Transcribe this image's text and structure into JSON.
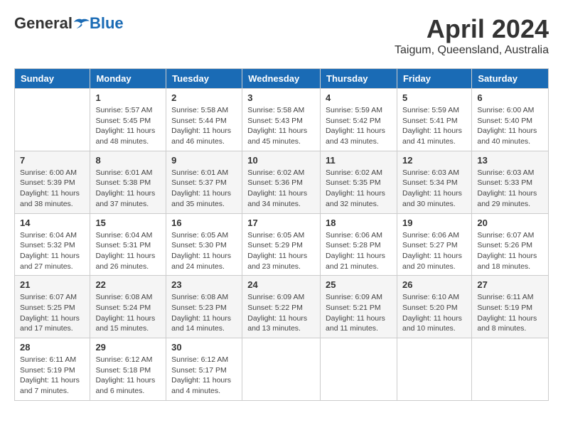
{
  "logo": {
    "general": "General",
    "blue": "Blue"
  },
  "title": "April 2024",
  "location": "Taigum, Queensland, Australia",
  "days_of_week": [
    "Sunday",
    "Monday",
    "Tuesday",
    "Wednesday",
    "Thursday",
    "Friday",
    "Saturday"
  ],
  "weeks": [
    [
      {
        "day": "",
        "info": ""
      },
      {
        "day": "1",
        "info": "Sunrise: 5:57 AM\nSunset: 5:45 PM\nDaylight: 11 hours\nand 48 minutes."
      },
      {
        "day": "2",
        "info": "Sunrise: 5:58 AM\nSunset: 5:44 PM\nDaylight: 11 hours\nand 46 minutes."
      },
      {
        "day": "3",
        "info": "Sunrise: 5:58 AM\nSunset: 5:43 PM\nDaylight: 11 hours\nand 45 minutes."
      },
      {
        "day": "4",
        "info": "Sunrise: 5:59 AM\nSunset: 5:42 PM\nDaylight: 11 hours\nand 43 minutes."
      },
      {
        "day": "5",
        "info": "Sunrise: 5:59 AM\nSunset: 5:41 PM\nDaylight: 11 hours\nand 41 minutes."
      },
      {
        "day": "6",
        "info": "Sunrise: 6:00 AM\nSunset: 5:40 PM\nDaylight: 11 hours\nand 40 minutes."
      }
    ],
    [
      {
        "day": "7",
        "info": "Sunrise: 6:00 AM\nSunset: 5:39 PM\nDaylight: 11 hours\nand 38 minutes."
      },
      {
        "day": "8",
        "info": "Sunrise: 6:01 AM\nSunset: 5:38 PM\nDaylight: 11 hours\nand 37 minutes."
      },
      {
        "day": "9",
        "info": "Sunrise: 6:01 AM\nSunset: 5:37 PM\nDaylight: 11 hours\nand 35 minutes."
      },
      {
        "day": "10",
        "info": "Sunrise: 6:02 AM\nSunset: 5:36 PM\nDaylight: 11 hours\nand 34 minutes."
      },
      {
        "day": "11",
        "info": "Sunrise: 6:02 AM\nSunset: 5:35 PM\nDaylight: 11 hours\nand 32 minutes."
      },
      {
        "day": "12",
        "info": "Sunrise: 6:03 AM\nSunset: 5:34 PM\nDaylight: 11 hours\nand 30 minutes."
      },
      {
        "day": "13",
        "info": "Sunrise: 6:03 AM\nSunset: 5:33 PM\nDaylight: 11 hours\nand 29 minutes."
      }
    ],
    [
      {
        "day": "14",
        "info": "Sunrise: 6:04 AM\nSunset: 5:32 PM\nDaylight: 11 hours\nand 27 minutes."
      },
      {
        "day": "15",
        "info": "Sunrise: 6:04 AM\nSunset: 5:31 PM\nDaylight: 11 hours\nand 26 minutes."
      },
      {
        "day": "16",
        "info": "Sunrise: 6:05 AM\nSunset: 5:30 PM\nDaylight: 11 hours\nand 24 minutes."
      },
      {
        "day": "17",
        "info": "Sunrise: 6:05 AM\nSunset: 5:29 PM\nDaylight: 11 hours\nand 23 minutes."
      },
      {
        "day": "18",
        "info": "Sunrise: 6:06 AM\nSunset: 5:28 PM\nDaylight: 11 hours\nand 21 minutes."
      },
      {
        "day": "19",
        "info": "Sunrise: 6:06 AM\nSunset: 5:27 PM\nDaylight: 11 hours\nand 20 minutes."
      },
      {
        "day": "20",
        "info": "Sunrise: 6:07 AM\nSunset: 5:26 PM\nDaylight: 11 hours\nand 18 minutes."
      }
    ],
    [
      {
        "day": "21",
        "info": "Sunrise: 6:07 AM\nSunset: 5:25 PM\nDaylight: 11 hours\nand 17 minutes."
      },
      {
        "day": "22",
        "info": "Sunrise: 6:08 AM\nSunset: 5:24 PM\nDaylight: 11 hours\nand 15 minutes."
      },
      {
        "day": "23",
        "info": "Sunrise: 6:08 AM\nSunset: 5:23 PM\nDaylight: 11 hours\nand 14 minutes."
      },
      {
        "day": "24",
        "info": "Sunrise: 6:09 AM\nSunset: 5:22 PM\nDaylight: 11 hours\nand 13 minutes."
      },
      {
        "day": "25",
        "info": "Sunrise: 6:09 AM\nSunset: 5:21 PM\nDaylight: 11 hours\nand 11 minutes."
      },
      {
        "day": "26",
        "info": "Sunrise: 6:10 AM\nSunset: 5:20 PM\nDaylight: 11 hours\nand 10 minutes."
      },
      {
        "day": "27",
        "info": "Sunrise: 6:11 AM\nSunset: 5:19 PM\nDaylight: 11 hours\nand 8 minutes."
      }
    ],
    [
      {
        "day": "28",
        "info": "Sunrise: 6:11 AM\nSunset: 5:19 PM\nDaylight: 11 hours\nand 7 minutes."
      },
      {
        "day": "29",
        "info": "Sunrise: 6:12 AM\nSunset: 5:18 PM\nDaylight: 11 hours\nand 6 minutes."
      },
      {
        "day": "30",
        "info": "Sunrise: 6:12 AM\nSunset: 5:17 PM\nDaylight: 11 hours\nand 4 minutes."
      },
      {
        "day": "",
        "info": ""
      },
      {
        "day": "",
        "info": ""
      },
      {
        "day": "",
        "info": ""
      },
      {
        "day": "",
        "info": ""
      }
    ]
  ]
}
